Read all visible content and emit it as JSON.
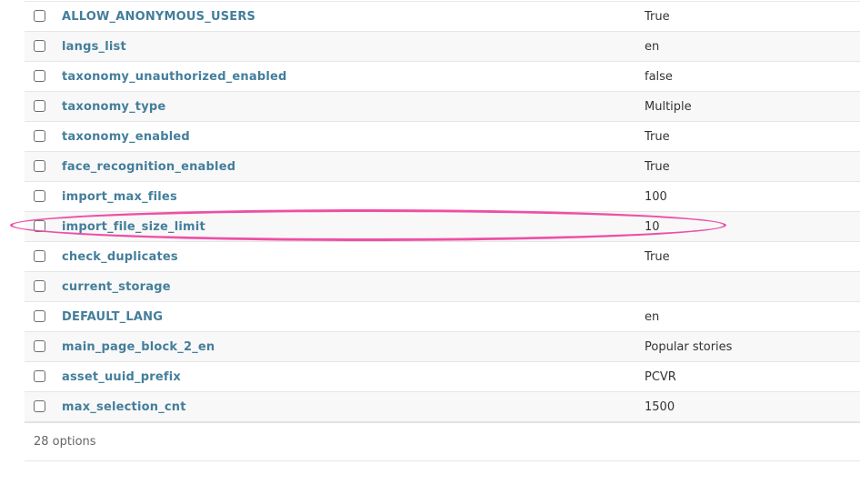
{
  "rows": [
    {
      "name": "ALLOW_ANONYMOUS_USERS",
      "value": "True"
    },
    {
      "name": "langs_list",
      "value": "en"
    },
    {
      "name": "taxonomy_unauthorized_enabled",
      "value": "false"
    },
    {
      "name": "taxonomy_type",
      "value": "Multiple"
    },
    {
      "name": "taxonomy_enabled",
      "value": "True"
    },
    {
      "name": "face_recognition_enabled",
      "value": "True"
    },
    {
      "name": "import_max_files",
      "value": "100"
    },
    {
      "name": "import_file_size_limit",
      "value": "10"
    },
    {
      "name": "check_duplicates",
      "value": "True"
    },
    {
      "name": "current_storage",
      "value": ""
    },
    {
      "name": "DEFAULT_LANG",
      "value": "en"
    },
    {
      "name": "main_page_block_2_en",
      "value": "Popular stories"
    },
    {
      "name": "asset_uuid_prefix",
      "value": "PCVR"
    },
    {
      "name": "max_selection_cnt",
      "value": "1500"
    }
  ],
  "footer": {
    "count_label": "28 options"
  },
  "annotation": {
    "highlighted_row": "import_file_size_limit",
    "color": "#ee4fa6"
  }
}
